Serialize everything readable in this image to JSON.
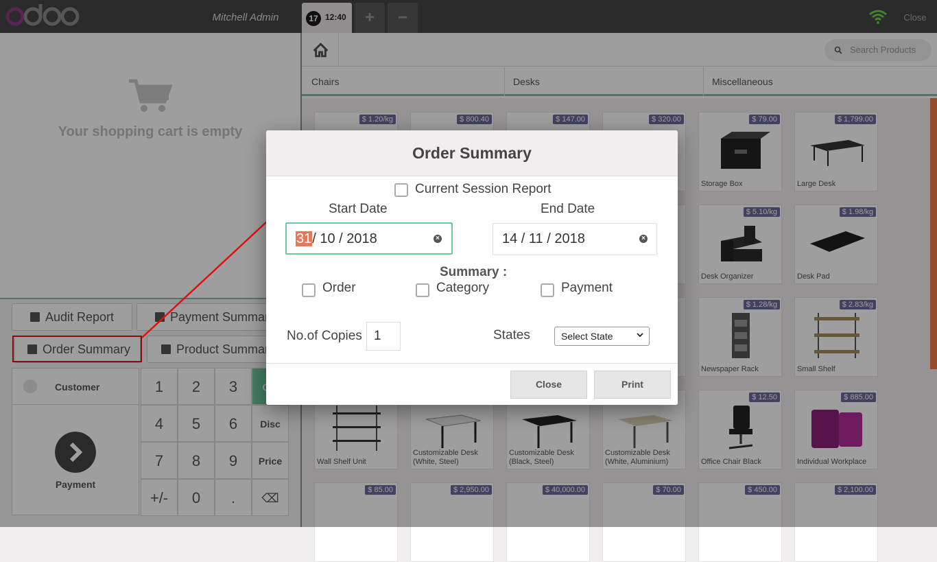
{
  "topbar": {
    "logo_text": "odoo",
    "cashier": "Mitchell Admin",
    "order_number": "17",
    "order_time": "12:40",
    "add_order": "+",
    "remove_order": "−",
    "close": "Close"
  },
  "cart": {
    "empty_text": "Your shopping cart is empty"
  },
  "control_buttons": {
    "audit": "Audit Report",
    "payment_summary": "Payment Summary",
    "order_summary": "Order Summary",
    "product_summary": "Product Summary"
  },
  "customer": "Customer",
  "payment": "Payment",
  "numpad": {
    "k1": "1",
    "k2": "2",
    "k3": "3",
    "qty": "Qty",
    "k4": "4",
    "k5": "5",
    "k6": "6",
    "disc": "Disc",
    "k7": "7",
    "k8": "8",
    "k9": "9",
    "price": "Price",
    "sign": "+/-",
    "k0": "0",
    "dot": ".",
    "backspace": "⌫"
  },
  "search": {
    "placeholder": "Search Products"
  },
  "categories": [
    "Chairs",
    "Desks",
    "Miscellaneous"
  ],
  "products": [
    {
      "price": "$ 1.20/kg",
      "name": ""
    },
    {
      "price": "$ 800.40",
      "name": ""
    },
    {
      "price": "$ 147.00",
      "name": ""
    },
    {
      "price": "$ 320.00",
      "name": ""
    },
    {
      "price": "$ 79.00",
      "name": "Storage Box"
    },
    {
      "price": "$ 1,799.00",
      "name": "Large Desk"
    },
    {
      "price": "$ 5.10/kg",
      "name": "Desk Organizer"
    },
    {
      "price": "$ 1.98/kg",
      "name": "Desk Pad"
    },
    {
      "price": "$ 1.28/kg",
      "name": "Newspaper Rack"
    },
    {
      "price": "$ 2.83/kg",
      "name": "Small Shelf"
    },
    {
      "price": "",
      "name": "Wall Shelf Unit"
    },
    {
      "price": "",
      "name": "Customizable Desk (White, Steel)"
    },
    {
      "price": "",
      "name": "Customizable Desk (Black, Steel)"
    },
    {
      "price": "",
      "name": "Customizable Desk (White, Aluminium)"
    },
    {
      "price": "$ 12.50",
      "name": "Office Chair Black"
    },
    {
      "price": "$ 885.00",
      "name": "Individual Workplace"
    },
    {
      "price": "$ 85.00",
      "name": ""
    },
    {
      "price": "$ 2,950.00",
      "name": ""
    },
    {
      "price": "$ 40,000.00",
      "name": ""
    },
    {
      "price": "$ 70.00",
      "name": ""
    },
    {
      "price": "$ 450.00",
      "name": ""
    },
    {
      "price": "$ 2,100.00",
      "name": ""
    }
  ],
  "dialog": {
    "title": "Order Summary",
    "current_session": "Current Session Report",
    "start_label": "Start Date",
    "end_label": "End Date",
    "start_day": "31",
    "start_rest": "/ 10 / 2018",
    "end_date": "14 / 11 / 2018",
    "summary_label": "Summary :",
    "opt_order": "Order",
    "opt_category": "Category",
    "opt_payment": "Payment",
    "copies_label": "No.of Copies",
    "copies_value": "1",
    "states_label": "States",
    "state_select": "Select State",
    "close": "Close",
    "print": "Print"
  },
  "colors": {
    "accent": "#6ec89b",
    "highlight": "#e01010",
    "price_badge": "#6b6b9c",
    "date_highlight": "#e6785a"
  }
}
